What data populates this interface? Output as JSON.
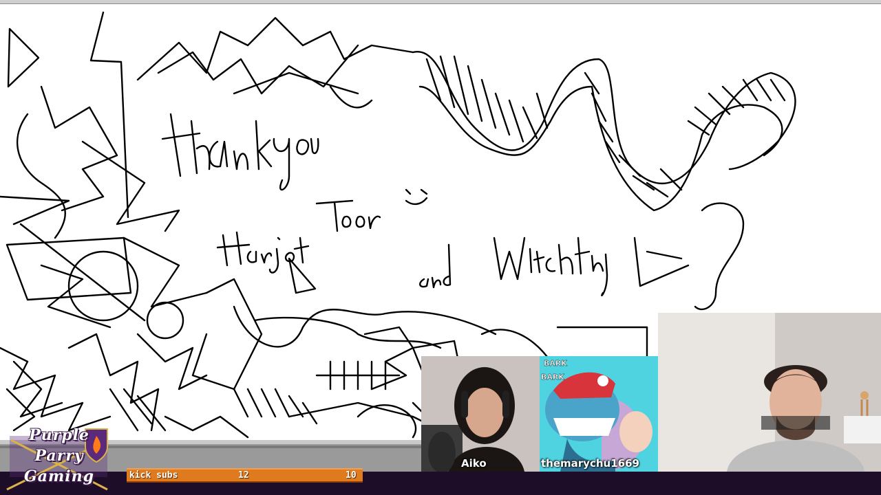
{
  "drawing": {
    "text_lines": [
      "thank you",
      "Harjot Toor",
      "and Witchfury"
    ]
  },
  "overlay": {
    "logo_lines": [
      "Purple",
      "Parry",
      "Gaming"
    ],
    "kick_bar": {
      "label": "kick subs",
      "current": "12",
      "goal": "10",
      "fill_color": "#e07a1f"
    }
  },
  "cams": [
    {
      "name": "Aiko"
    },
    {
      "name": "themarychu1669"
    },
    {
      "name": ""
    }
  ],
  "colors": {
    "canvas": "#ffffff",
    "ink": "#000000",
    "bottom_bar": "#1e0d28"
  }
}
